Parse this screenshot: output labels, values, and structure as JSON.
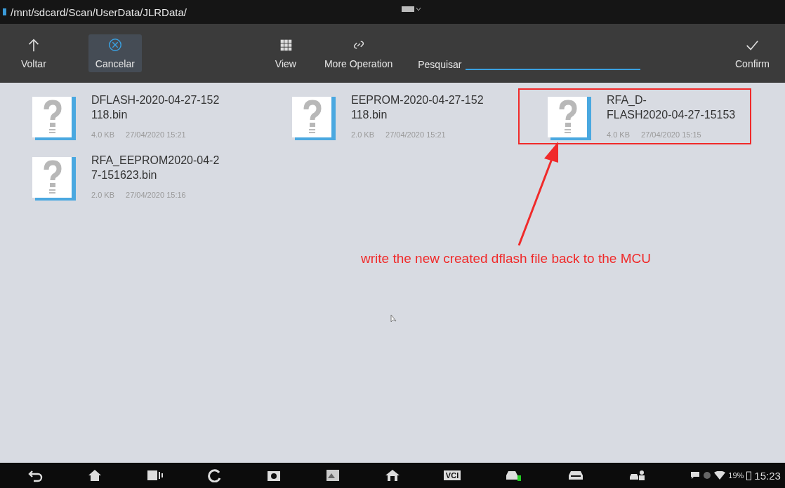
{
  "path_bar": {
    "path": "/mnt/sdcard/Scan/UserData/JLRData/"
  },
  "toolbar": {
    "buttons": [
      {
        "kind": "up",
        "label": "Voltar",
        "active": false
      },
      {
        "kind": "cancel",
        "label": "Cancelar",
        "active": true
      },
      {
        "kind": "grid",
        "label": "View",
        "active": false
      },
      {
        "kind": "link",
        "label": "More Operation",
        "active": false
      }
    ],
    "search": {
      "label": "Pesquisar"
    },
    "confirm": {
      "label": "Confirm"
    }
  },
  "files": [
    {
      "name_lines": [
        "DFLASH-2020-04-27-152",
        "118.bin"
      ],
      "size": "4.0 KB",
      "date": "27/04/2020 15:21",
      "highlighted": false
    },
    {
      "name_lines": [
        "EEPROM-2020-04-27-152",
        "118.bin"
      ],
      "size": "2.0 KB",
      "date": "27/04/2020 15:21",
      "highlighted": false
    },
    {
      "name_lines": [
        "RFA_D-",
        "FLASH2020-04-27-15153"
      ],
      "size": "4.0 KB",
      "date": "27/04/2020 15:15",
      "highlighted": true
    },
    {
      "name_lines": [
        "RFA_EEPROM2020-04-2",
        "7-151623.bin"
      ],
      "size": "2.0 KB",
      "date": "27/04/2020 15:16",
      "highlighted": false
    }
  ],
  "annotation": {
    "text": "write the new created dflash file back to the MCU"
  },
  "nav_bar": {
    "vci_label": "VCI",
    "battery": "19%",
    "time": "15:23"
  }
}
